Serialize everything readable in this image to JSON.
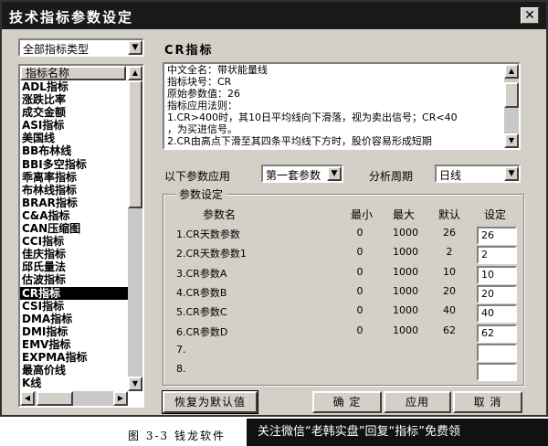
{
  "window": {
    "title": "技术指标参数设定",
    "close_glyph": "✕"
  },
  "left": {
    "category_value": "全部指标类型",
    "list_header": "指标名称",
    "items": [
      "ADL指标",
      "涨跌比率",
      "成交金额",
      "ASI指标",
      "美国线",
      "BB布林线",
      "BBI多空指标",
      "乖离率指标",
      "布林线指标",
      "BRAR指标",
      "C&A指标",
      "CAN压缩图",
      "CCI指标",
      "佳庆指标",
      "邱氏量法",
      "估波指标",
      "CR指标",
      "CSI指标",
      "DMA指标",
      "DMI指标",
      "EMV指标",
      "EXPMA指标",
      "最高价线",
      "K线"
    ],
    "selected_index": 16
  },
  "right": {
    "section_title": "CR指标",
    "info_lines": [
      "中文全名：带状能量线",
      "指标块号：CR",
      "原始参数值：26",
      "指标应用法则：",
      "1.CR>400时，其10日平均线向下滑落，视为卖出信号；CR<40",
      "，为买进信号。",
      "2.CR由高点下滑至其四条平均线下方时，股价容易形成短期"
    ],
    "apply_label": "以下参数应用",
    "param_set_value": "第一套参数",
    "period_label": "分析周期",
    "period_value": "日线",
    "group_title": "参数设定",
    "headers": {
      "name": "参数名",
      "min": "最小",
      "max": "最大",
      "default": "默认",
      "setting": "设定"
    },
    "rows": [
      {
        "name": "1.CR天数参数",
        "min": "0",
        "max": "1000",
        "default": "26",
        "setting": "26"
      },
      {
        "name": "2.CR天数参数1",
        "min": "0",
        "max": "1000",
        "default": "2",
        "setting": "2"
      },
      {
        "name": "3.CR参数A",
        "min": "0",
        "max": "1000",
        "default": "10",
        "setting": "10"
      },
      {
        "name": "4.CR参数B",
        "min": "0",
        "max": "1000",
        "default": "20",
        "setting": "20"
      },
      {
        "name": "5.CR参数C",
        "min": "0",
        "max": "1000",
        "default": "40",
        "setting": "40"
      },
      {
        "name": "6.CR参数D",
        "min": "0",
        "max": "1000",
        "default": "62",
        "setting": "62"
      },
      {
        "name": "7.",
        "min": "",
        "max": "",
        "default": "",
        "setting": ""
      },
      {
        "name": "8.",
        "min": "",
        "max": "",
        "default": "",
        "setting": ""
      }
    ]
  },
  "buttons": {
    "restore": "恢复为默认值",
    "ok": "确 定",
    "apply": "应用",
    "cancel": "取 消"
  },
  "caption": "图 3-3   钱龙软件",
  "watermark": "关注微信“老韩实盘”回复“指标”免费领"
}
